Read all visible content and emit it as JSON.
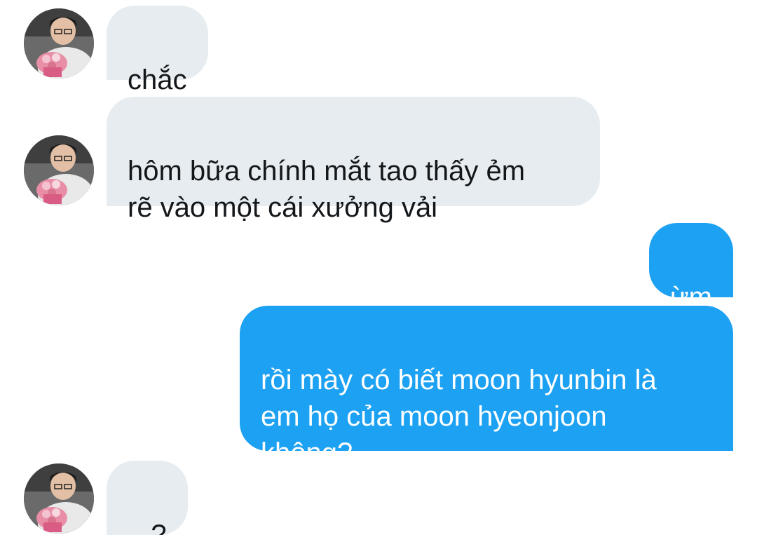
{
  "messages": [
    {
      "direction": "incoming",
      "text": "chắc"
    },
    {
      "direction": "incoming",
      "text": "hôm bữa chính mắt tao thấy ẻm\nrẽ vào một cái xưởng vải"
    },
    {
      "direction": "outgoing",
      "text": "ừm"
    },
    {
      "direction": "outgoing",
      "text": "rồi mày có biết moon hyunbin là\nem họ của moon hyeonjoon\nkhông?"
    },
    {
      "direction": "incoming",
      "text": "...?"
    }
  ],
  "colors": {
    "incoming_bubble": "#e6ecf0",
    "outgoing_bubble": "#1da1f2"
  },
  "icons": {
    "avatar": "profile-photo-person-holding-bouquet"
  }
}
